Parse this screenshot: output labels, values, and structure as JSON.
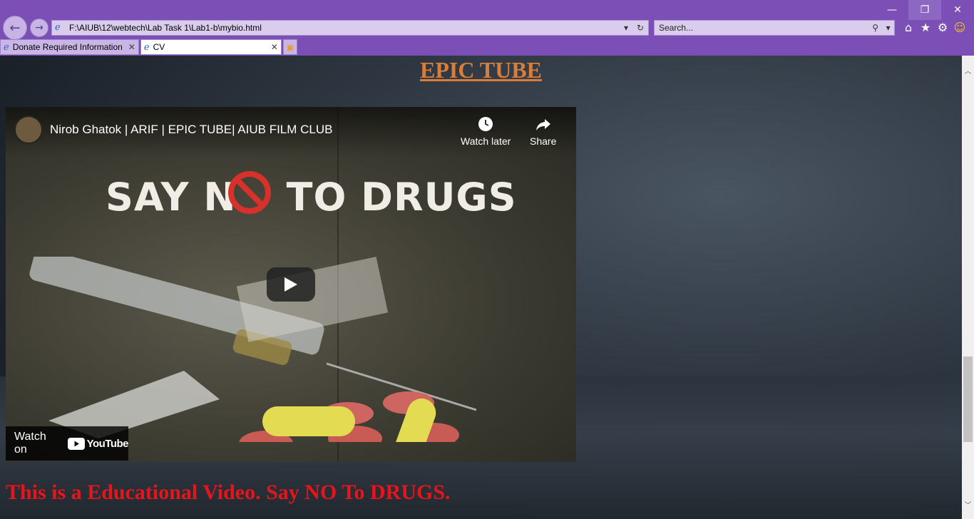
{
  "browser": {
    "address": "F:\\AIUB\\12\\webtech\\Lab Task 1\\Lab1-b\\mybio.html",
    "search_placeholder": "Search...",
    "tabs": [
      {
        "label": "Donate Required Information",
        "active": false
      },
      {
        "label": "CV",
        "active": true
      }
    ],
    "window_controls": {
      "minimize": "—",
      "restore": "❐",
      "close": "✕"
    }
  },
  "page": {
    "heading": "EPIC TUBE",
    "caption": "This is a Educational Video. Say NO To DRUGS."
  },
  "video": {
    "title": "Nirob Ghatok | ARIF | EPIC TUBE| AIUB FILM CLUB",
    "watch_later": "Watch later",
    "share": "Share",
    "watch_on": "Watch on",
    "youtube": "YouTube",
    "slogan_left": "SAY N",
    "slogan_right": "TO DRUGS"
  },
  "colors": {
    "chrome": "#7b4fb5",
    "heading": "#d87d3a",
    "caption": "#e8141b"
  },
  "icons": [
    "back-icon",
    "forward-icon",
    "ie-icon",
    "refresh-icon",
    "search-icon",
    "home-icon",
    "star-icon",
    "gear-icon",
    "smiley-icon",
    "clock-icon",
    "share-icon",
    "play-icon",
    "youtube-icon"
  ]
}
